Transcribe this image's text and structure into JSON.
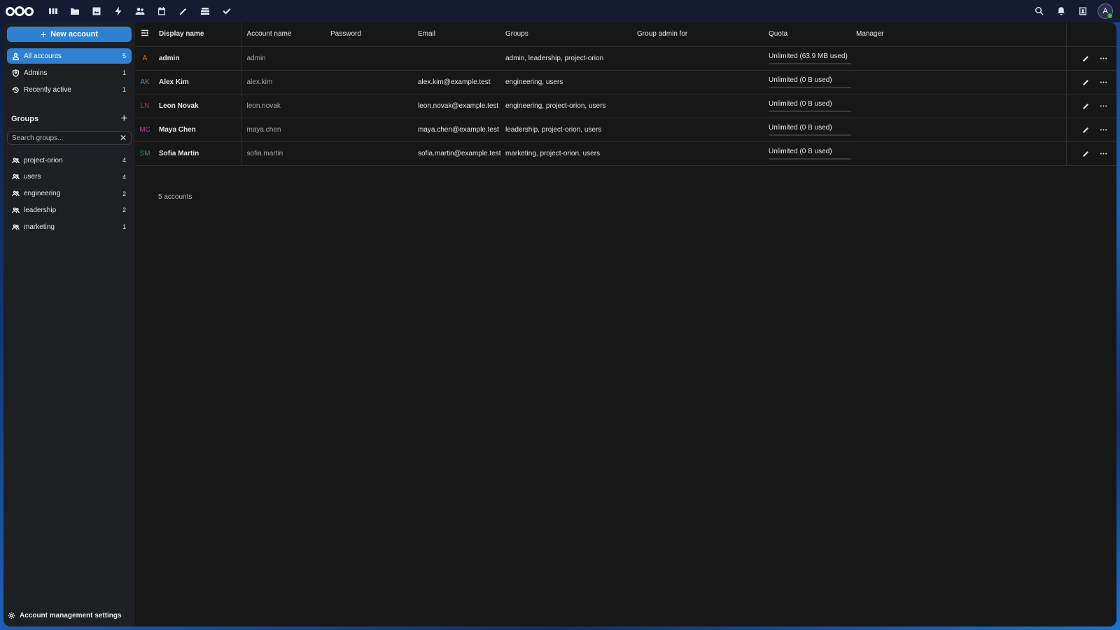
{
  "header": {
    "apps": [
      {
        "name": "dashboard-icon"
      },
      {
        "name": "files-icon"
      },
      {
        "name": "photos-icon"
      },
      {
        "name": "activity-icon"
      },
      {
        "name": "contacts-icon"
      },
      {
        "name": "calendar-icon"
      },
      {
        "name": "notes-icon"
      },
      {
        "name": "deck-icon"
      },
      {
        "name": "tasks-icon"
      }
    ],
    "avatar_initial": "A"
  },
  "sidebar": {
    "new_account_label": "New account",
    "nav": [
      {
        "label": "All accounts",
        "count": "5"
      },
      {
        "label": "Admins",
        "count": "1"
      },
      {
        "label": "Recently active",
        "count": "1"
      }
    ],
    "groups_heading": "Groups",
    "search_placeholder": "Search groups...",
    "groups": [
      {
        "label": "project-orion",
        "count": "4"
      },
      {
        "label": "users",
        "count": "4"
      },
      {
        "label": "engineering",
        "count": "2"
      },
      {
        "label": "leadership",
        "count": "2"
      },
      {
        "label": "marketing",
        "count": "1"
      }
    ],
    "settings_label": "Account management settings"
  },
  "table": {
    "headers": {
      "display_name": "Display name",
      "account_name": "Account name",
      "password": "Password",
      "email": "Email",
      "groups": "Groups",
      "group_admin": "Group admin for",
      "quota": "Quota",
      "manager": "Manager"
    },
    "rows": [
      {
        "initials": "A",
        "color": "#c7722f",
        "display": "admin",
        "account": "admin",
        "email": "",
        "groups": "admin, leadership, project-orion",
        "quota": "Unlimited (63.9 MB used)",
        "quota_fraction": 0
      },
      {
        "initials": "AK",
        "color": "#3a8fc9",
        "display": "Alex Kim",
        "account": "alex.kim",
        "email": "alex.kim@example.test",
        "groups": "engineering, users",
        "quota": "Unlimited (0 B used)",
        "quota_fraction": 0
      },
      {
        "initials": "LN",
        "color": "#b0363a",
        "display": "Leon Novak",
        "account": "leon.novak",
        "email": "leon.novak@example.test",
        "groups": "engineering, project-orion, users",
        "quota": "Unlimited (0 B used)",
        "quota_fraction": 0
      },
      {
        "initials": "MC",
        "color": "#a8468e",
        "display": "Maya Chen",
        "account": "maya.chen",
        "email": "maya.chen@example.test",
        "groups": "leadership, project-orion, users",
        "quota": "Unlimited (0 B used)",
        "quota_fraction": 0
      },
      {
        "initials": "SM",
        "color": "#3e8a6a",
        "display": "Sofia Martin",
        "account": "sofia.martin",
        "email": "sofia.martin@example.test",
        "groups": "marketing, project-orion, users",
        "quota": "Unlimited (0 B used)",
        "quota_fraction": 0
      }
    ],
    "footer_count": "5 accounts"
  }
}
